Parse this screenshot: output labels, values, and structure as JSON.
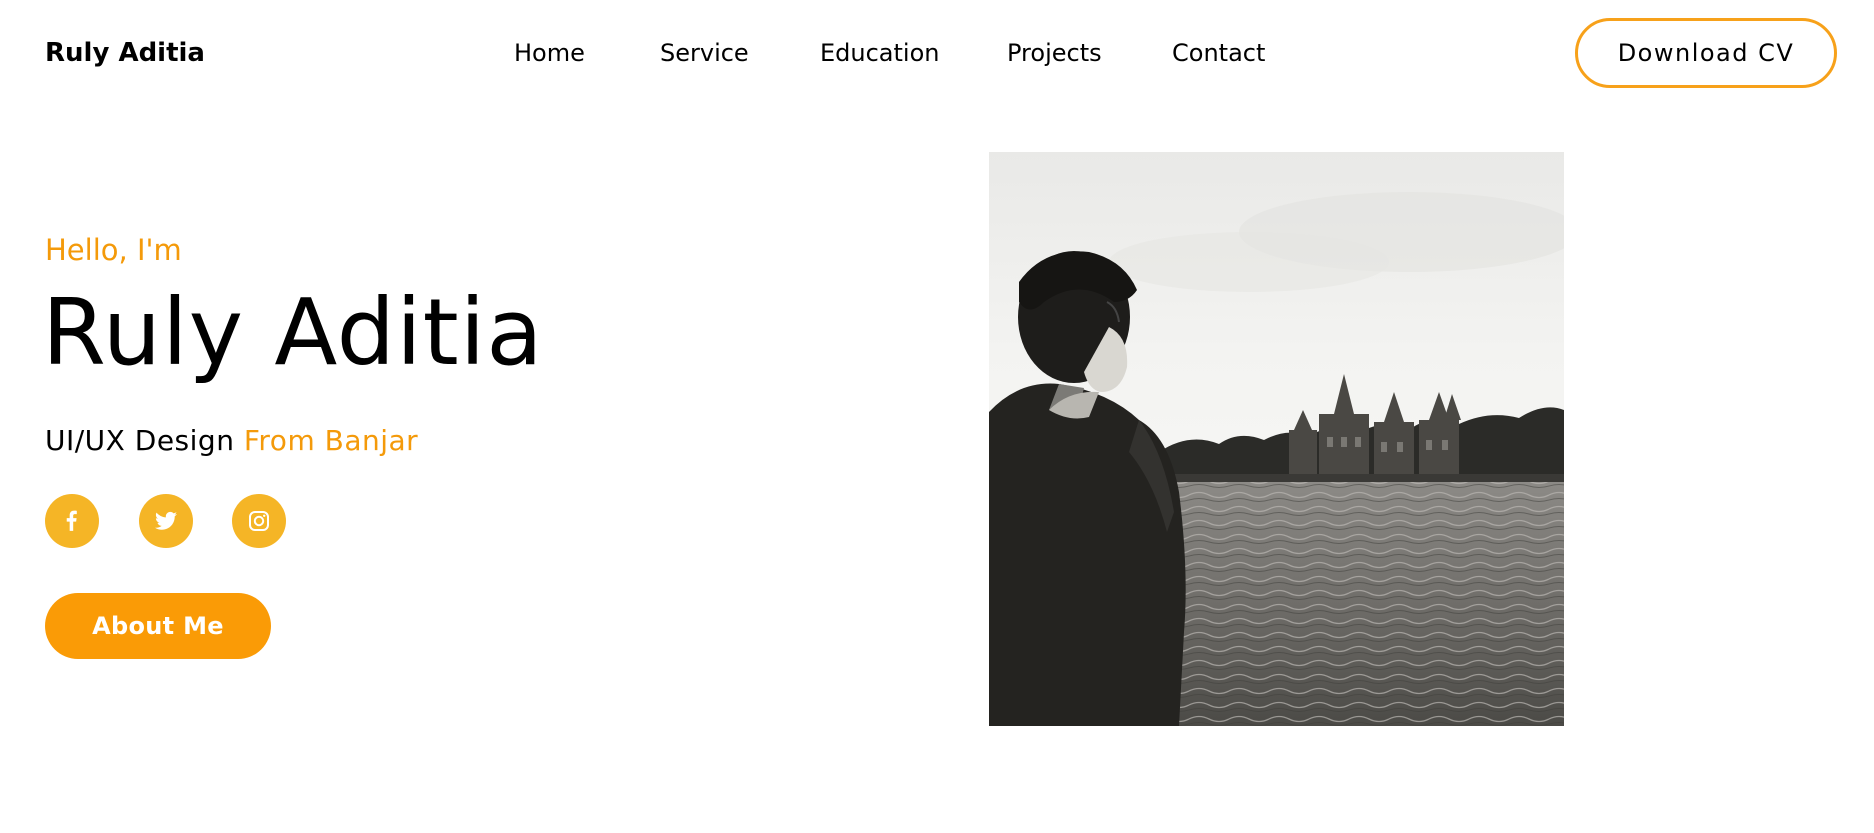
{
  "header": {
    "brand": "Ruly Aditia",
    "nav": [
      "Home",
      "Service",
      "Education",
      "Projects",
      "Contact"
    ],
    "cta_label": "Download CV"
  },
  "hero": {
    "greeting": "Hello, I'm",
    "name": "Ruly Aditia",
    "role_prefix": "UI/UX Design",
    "role_accent": "From Banjar",
    "about_label": "About Me",
    "social_icons": [
      "facebook-icon",
      "twitter-icon",
      "instagram-icon"
    ]
  },
  "colors": {
    "accent": "#f49a0a",
    "button": "#fa9b06",
    "social_circle": "#f5b526",
    "cv_border": "#f7a11a"
  }
}
